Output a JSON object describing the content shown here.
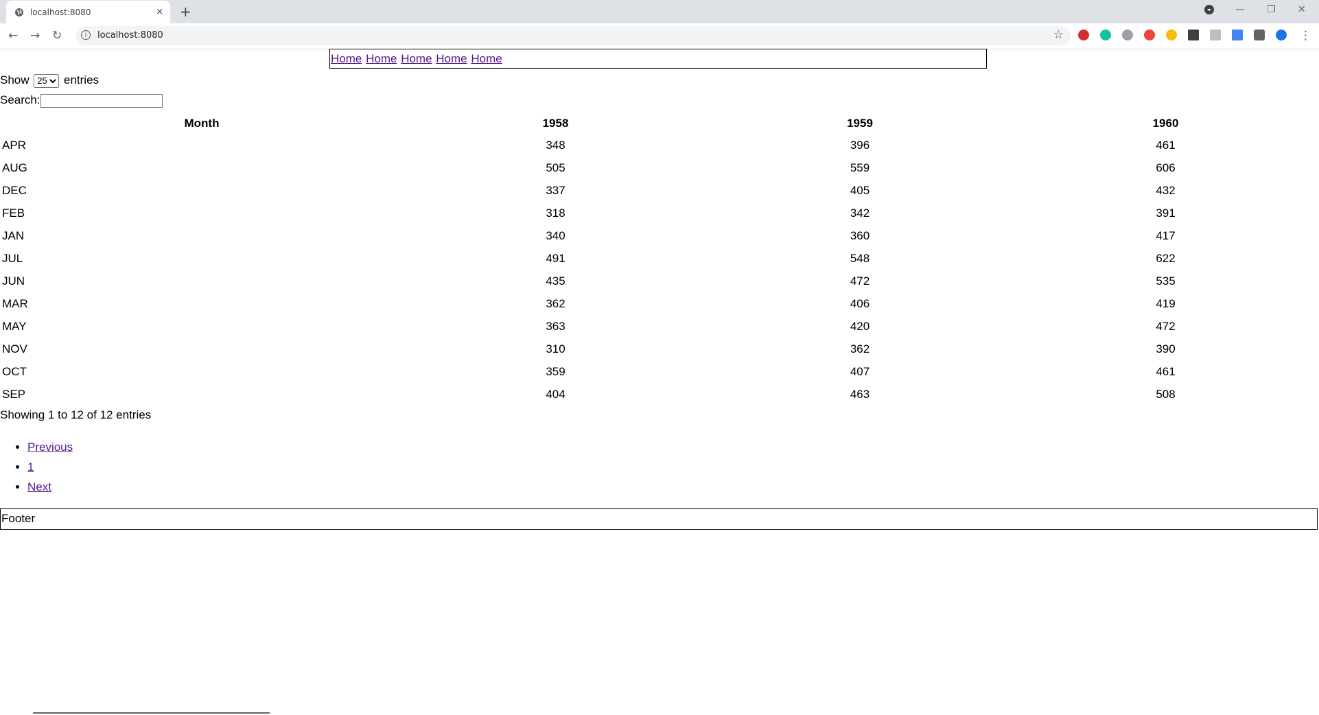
{
  "browser": {
    "tab_title": "localhost:8080",
    "tab_close": "×",
    "new_tab": "+",
    "url": "localhost:8080",
    "minimize": "—",
    "restore": "❐",
    "close": "✕"
  },
  "nav": {
    "links": [
      "Home",
      "Home",
      "Home",
      "Home",
      "Home"
    ]
  },
  "controls": {
    "show_label": "Show",
    "entries_value": "25",
    "entries_label": "entries",
    "search_label": "Search:",
    "search_value": ""
  },
  "table": {
    "columns": [
      "Month",
      "1958",
      "1959",
      "1960"
    ],
    "rows": [
      [
        "APR",
        "348",
        "396",
        "461"
      ],
      [
        "AUG",
        "505",
        "559",
        "606"
      ],
      [
        "DEC",
        "337",
        "405",
        "432"
      ],
      [
        "FEB",
        "318",
        "342",
        "391"
      ],
      [
        "JAN",
        "340",
        "360",
        "417"
      ],
      [
        "JUL",
        "491",
        "548",
        "622"
      ],
      [
        "JUN",
        "435",
        "472",
        "535"
      ],
      [
        "MAR",
        "362",
        "406",
        "419"
      ],
      [
        "MAY",
        "363",
        "420",
        "472"
      ],
      [
        "NOV",
        "310",
        "362",
        "390"
      ],
      [
        "OCT",
        "359",
        "407",
        "461"
      ],
      [
        "SEP",
        "404",
        "463",
        "508"
      ]
    ]
  },
  "info": "Showing 1 to 12 of 12 entries",
  "pagination": {
    "previous": "Previous",
    "page": "1",
    "next": "Next"
  },
  "footer": "Footer"
}
